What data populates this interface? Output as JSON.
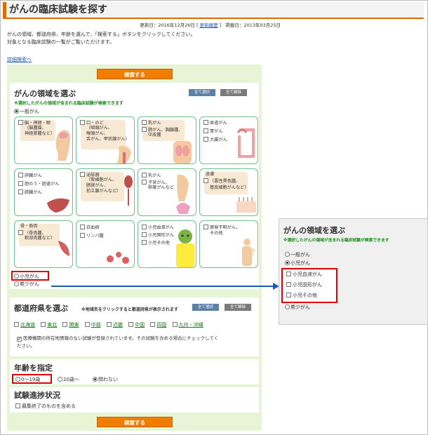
{
  "page": {
    "title": "がんの臨床試験を探す",
    "updated_label": "更新日：2016年12月26日",
    "history_link": "更新履歴",
    "posted_label": "掲載日：2013年03月25日",
    "intro_line1": "がんの領域、都道府県、年齢を選んで、「検索する」ボタンをクリックしてください。",
    "intro_line2": "対象となる臨床試験の一覧がご覧いただけます。",
    "detail_link": "詳細検索へ",
    "search_button": "検索する"
  },
  "area": {
    "title": "がんの領域を選ぶ",
    "note": "※選択したがんの領域が含まれる臨床試験が検索できます",
    "select_all": "全て選択",
    "clear_all": "全て解除",
    "general_radio": "一般がん",
    "pediatric_radio": "小児がん",
    "rare_radio": "希少がん",
    "cells": [
      {
        "options": [
          "脳・神経・眼",
          "（脳腫瘍、",
          "神経膠腫など）"
        ]
      },
      {
        "options": [
          "口・のど",
          "（咽頭がん、",
          "喉頭がん、",
          "舌がん、甲状腺がん）"
        ]
      },
      {
        "options": [
          "乳がん",
          "肺がん、胸腺腫、",
          "中皮腫"
        ]
      },
      {
        "options": [
          "食道がん",
          "胃がん",
          "大腸がん"
        ]
      },
      {
        "options": [
          "肝臓がん",
          "胆のう・胆道がん",
          "膵臓がん"
        ]
      },
      {
        "options": [
          "泌尿器",
          "（腎細胞がん、",
          "膀胱がん、",
          "前立腺がんなど）"
        ]
      },
      {
        "options": [
          "乳がん",
          "子宮がん、",
          "卵巣がんなど"
        ]
      },
      {
        "options": [
          "皮膚",
          "（悪性黒色腫、",
          "基底細胞がんなど）"
        ]
      },
      {
        "options": [
          "骨・筋肉",
          "（骨肉腫、",
          "軟部肉腫など）"
        ]
      },
      {
        "options": [
          "白血病",
          "リンパ腫"
        ]
      },
      {
        "options": [
          "小児血液がん",
          "小児固形がん",
          "小児その他"
        ]
      },
      {
        "options": [
          "原発不明がん、",
          "その他"
        ]
      }
    ]
  },
  "prefecture": {
    "title": "都道府県を選ぶ",
    "note": "※地域名をクリックすると都道府県が表示されます",
    "select_all": "全て選択",
    "clear_all": "全て解除",
    "regions": [
      "北海道",
      "東北",
      "関東",
      "中部",
      "近畿",
      "中国",
      "四国",
      "九州・沖縄"
    ],
    "include_line1": "医療機関の所在地情報のない試験が登録されています。その試験を含める場合にチェックしてく",
    "include_line2": "ださい。"
  },
  "age": {
    "title": "年齢を指定",
    "options": [
      "0〜19歳",
      "20歳〜",
      "問わない"
    ]
  },
  "progress": {
    "title": "試験進捗状況",
    "option": "募集終了のものを含める"
  },
  "callout": {
    "title": "がんの領域を選ぶ",
    "note": "※選択したがんの領域が含まれる臨床試験が検索できます",
    "general_radio": "一般がん",
    "pediatric_radio": "小児がん",
    "options": [
      "小児血液がん",
      "小児固形がん",
      "小児その他"
    ],
    "rare_radio": "希少がん"
  },
  "colors": {
    "accent": "#e06a00",
    "panel_bg": "#e8f4d6",
    "highlight": "#e00000",
    "arrow": "#1f5ab3"
  }
}
